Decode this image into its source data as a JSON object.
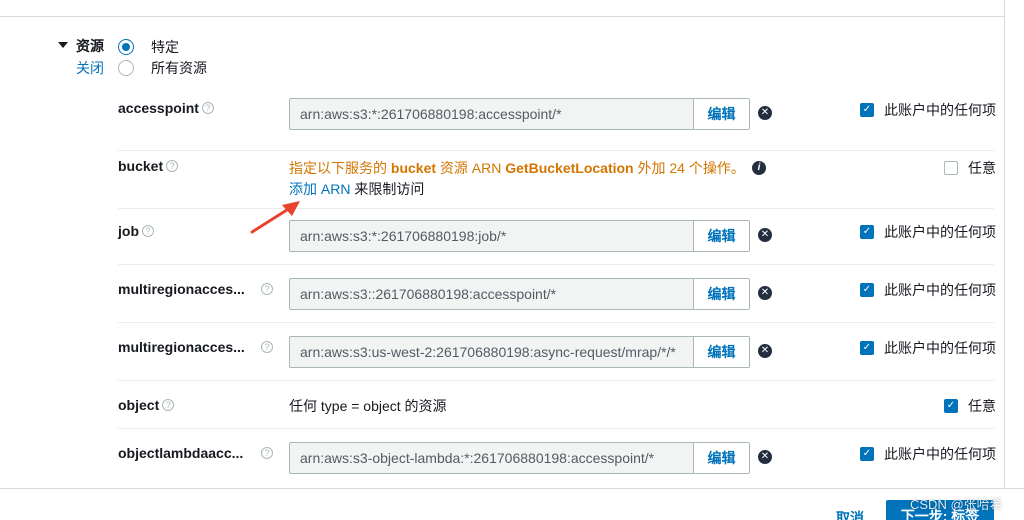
{
  "section": {
    "title": "资源",
    "close_link": "关闭"
  },
  "scope_options": [
    {
      "label": "特定",
      "selected": true
    },
    {
      "label": "所有资源",
      "selected": false
    }
  ],
  "rows": [
    {
      "name": "accesspoint",
      "arn": "arn:aws:s3:*:261706880198:accesspoint/*",
      "edit": "编辑",
      "check_label": "此账户中的任何项",
      "checked": true
    },
    {
      "name": "bucket",
      "warning_prefix": "指定以下服务的 ",
      "warning_bold1": "bucket",
      "warning_mid": " 资源 ARN ",
      "warning_bold2": "GetBucketLocation",
      "warning_suffix": " 外加 24 个操作。",
      "add_link": "添加 ARN",
      "add_rest": " 来限制访问",
      "check_label": "任意",
      "checked": false
    },
    {
      "name": "job",
      "arn": "arn:aws:s3:*:261706880198:job/*",
      "edit": "编辑",
      "check_label": "此账户中的任何项",
      "checked": true
    },
    {
      "name": "multiregionacces...",
      "arn": "arn:aws:s3::261706880198:accesspoint/*",
      "edit": "编辑",
      "check_label": "此账户中的任何项",
      "checked": true
    },
    {
      "name": "multiregionacces...",
      "arn": "arn:aws:s3:us-west-2:261706880198:async-request/mrap/*/*",
      "edit": "编辑",
      "check_label": "此账户中的任何项",
      "checked": true
    },
    {
      "name": "object",
      "text": "任何 type = object 的资源",
      "check_label": "任意",
      "checked": true
    },
    {
      "name": "objectlambdaacc...",
      "arn": "arn:aws:s3-object-lambda:*:261706880198:accesspoint/*",
      "edit": "编辑",
      "check_label": "此账户中的任何项",
      "checked": true
    }
  ],
  "footer": {
    "cancel": "取消",
    "next": "下一步: 标签"
  },
  "watermark": "CSDN @张哈希",
  "colors": {
    "link": "#0073bb",
    "warning": "#d47500",
    "annotation_arrow": "#e8412c"
  },
  "icons": {
    "remove": "times-circle-icon",
    "info": "info-circle-icon",
    "help": "question-circle-icon"
  }
}
